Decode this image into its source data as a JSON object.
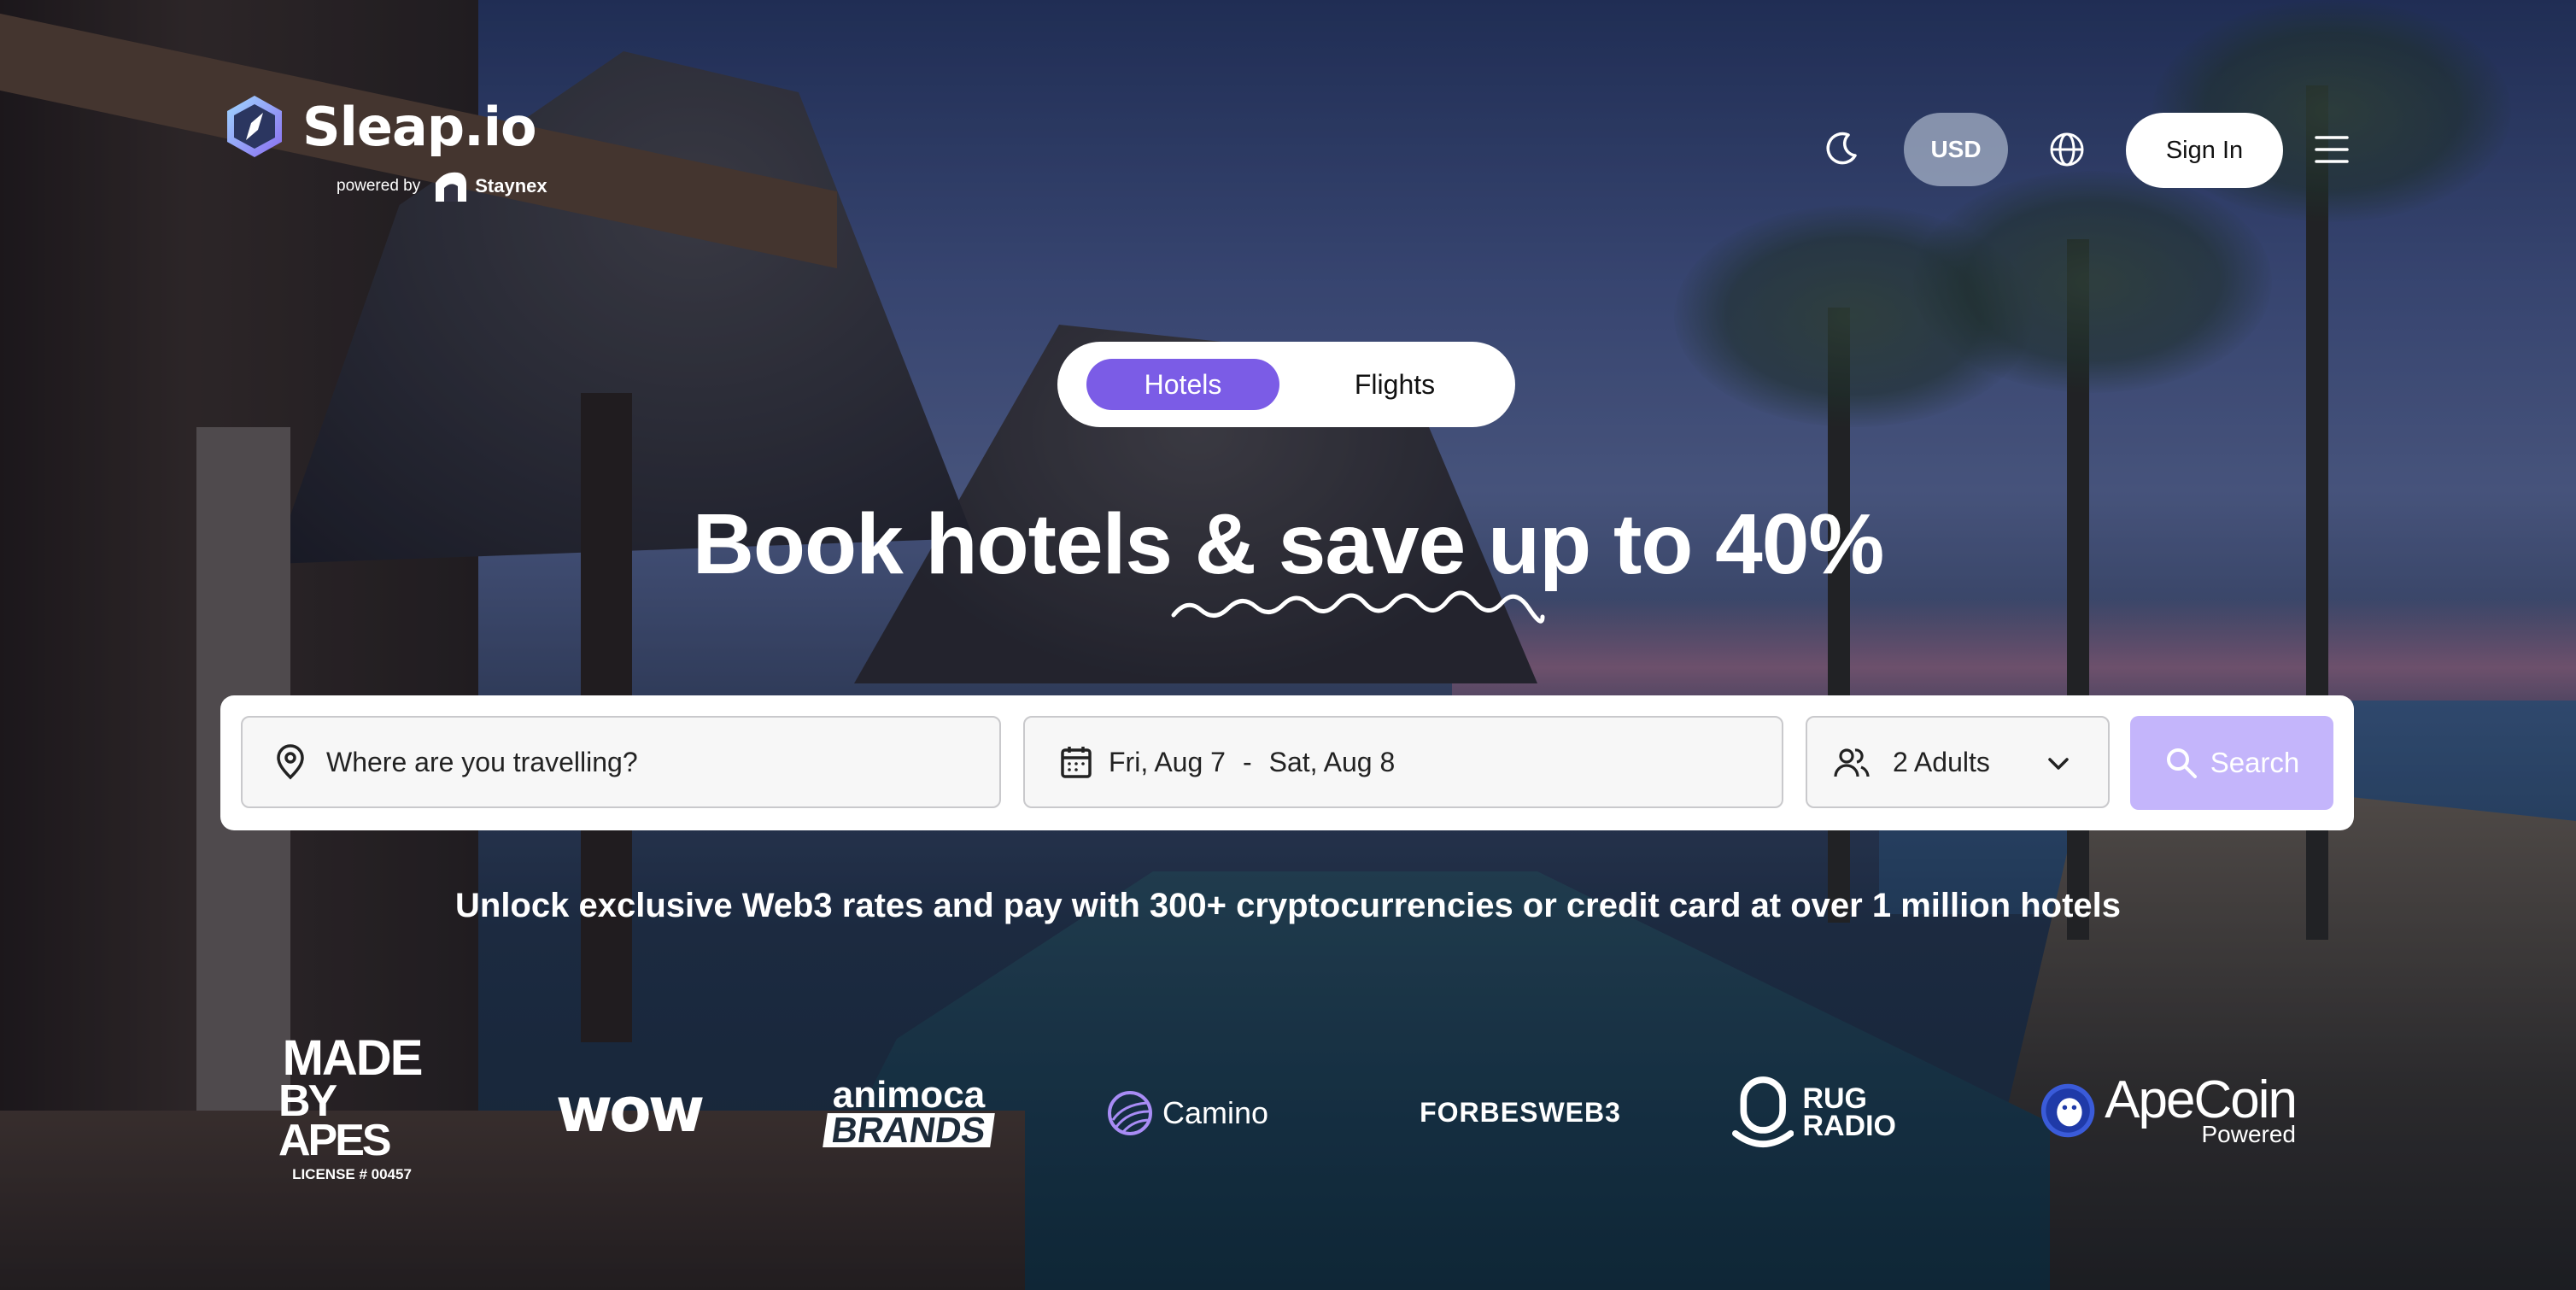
{
  "header": {
    "brand": "Sleap.io",
    "powered_by": "powered by",
    "partner_brand": "Staynex",
    "currency": "USD",
    "sign_in": "Sign In"
  },
  "tabs": [
    {
      "label": "Hotels",
      "active": true
    },
    {
      "label": "Flights",
      "active": false
    }
  ],
  "hero": {
    "headline": "Book hotels & save up to 40%",
    "subtitle": "Unlock exclusive Web3 rates and pay with 300+ cryptocurrencies or credit card at over 1 million hotels"
  },
  "search": {
    "destination_placeholder": "Where are you travelling?",
    "check_in": "Fri, Aug 7",
    "date_separator": "-",
    "check_out": "Sat, Aug 8",
    "guests": "2 Adults",
    "button": "Search"
  },
  "partners": {
    "made_by_apes": {
      "line1": "MADE",
      "line2": "BY APES",
      "license": "LICENSE # 00457"
    },
    "wow": "wow",
    "animoca": {
      "line1": "animoca",
      "line2": "BRANDS"
    },
    "camino": "Camino",
    "forbes": "FORBESWEB3",
    "rug_radio": {
      "line1": "RUG",
      "line2": "RADIO"
    },
    "apecoin": {
      "name": "ApeCoin",
      "sub": "Powered"
    }
  },
  "colors": {
    "accent": "#7b5ce6",
    "search_button": "#c4b5fb",
    "white": "#ffffff"
  },
  "icons": [
    "moon-icon",
    "globe-icon",
    "hamburger-menu-icon",
    "location-pin-icon",
    "calendar-icon",
    "users-icon",
    "chevron-down-icon",
    "search-icon"
  ]
}
